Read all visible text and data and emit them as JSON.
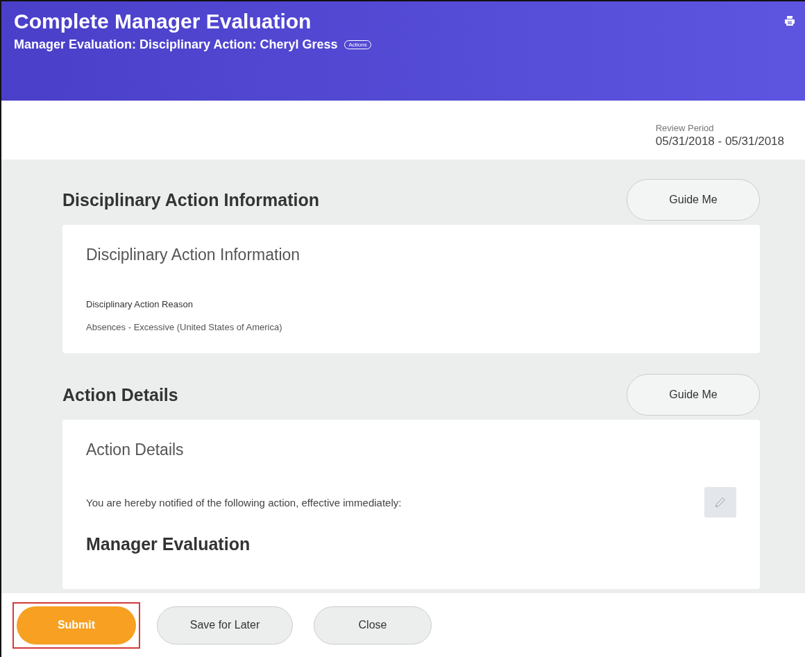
{
  "header": {
    "title": "Complete Manager Evaluation",
    "subtitle": "Manager Evaluation: Disciplinary Action: Cheryl Gress",
    "actions_label": "Actions"
  },
  "review_period": {
    "label": "Review Period",
    "value": "05/31/2018 - 05/31/2018"
  },
  "sections": [
    {
      "title": "Disciplinary Action Information",
      "guide_button": "Guide Me",
      "card_title": "Disciplinary Action Information",
      "items": [
        {
          "kind": "field",
          "label": "Disciplinary Action Reason",
          "value": "Absences - Excessive (United States of America)"
        }
      ]
    },
    {
      "title": "Action Details",
      "guide_button": "Guide Me",
      "card_title": "Action Details",
      "items": [
        {
          "kind": "editable-text",
          "text": "You are hereby notified of the following action, effective immediately:"
        },
        {
          "kind": "heading",
          "text": "Manager Evaluation"
        }
      ]
    }
  ],
  "footer_buttons": [
    {
      "label": "Submit",
      "kind": "primary",
      "highlighted": true
    },
    {
      "label": "Save for Later",
      "kind": "secondary",
      "highlighted": false
    },
    {
      "label": "Close",
      "kind": "secondary",
      "highlighted": false
    }
  ]
}
